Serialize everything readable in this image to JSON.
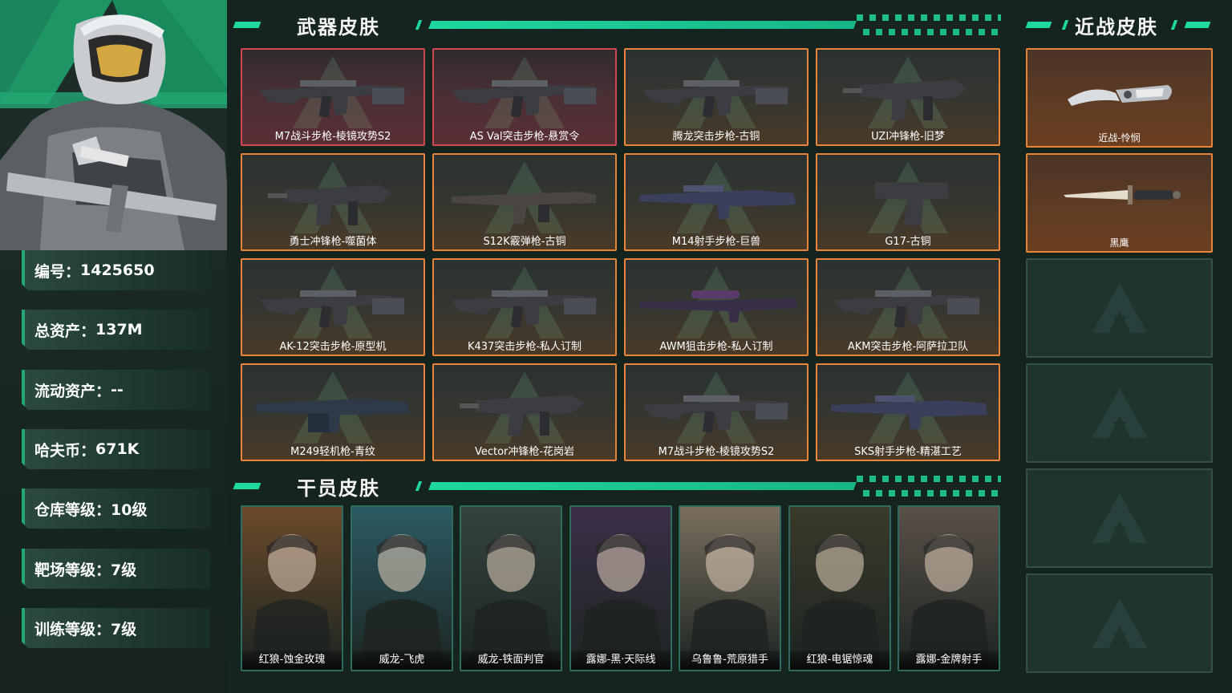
{
  "profile": {
    "stats": [
      {
        "label": "编号：",
        "value": "1425650"
      },
      {
        "label": "总资产：",
        "value": "137M"
      },
      {
        "label": "流动资产：",
        "value": "--"
      },
      {
        "label": "哈夫币：",
        "value": "671K"
      },
      {
        "label": "仓库等级：",
        "value": "10级"
      },
      {
        "label": "靶场等级：",
        "value": "7级"
      },
      {
        "label": "训练等级：",
        "value": "7级"
      }
    ]
  },
  "sections": {
    "weapon_title": "武器皮肤",
    "melee_title": "近战皮肤",
    "operator_title": "干员皮肤"
  },
  "weapons": [
    {
      "name": "M7战斗步枪-棱镜攻势S2",
      "rarity": "red",
      "icon": "rifle-icon"
    },
    {
      "name": "AS Val突击步枪-悬赏令",
      "rarity": "red",
      "icon": "rifle-icon"
    },
    {
      "name": "腾龙突击步枪-古铜",
      "rarity": "orange",
      "icon": "rifle-icon"
    },
    {
      "name": "UZI冲锋枪-旧梦",
      "rarity": "orange",
      "icon": "smg-icon"
    },
    {
      "name": "勇士冲锋枪-噬菌体",
      "rarity": "orange",
      "icon": "smg-icon"
    },
    {
      "name": "S12K霰弹枪-古铜",
      "rarity": "orange",
      "icon": "shotgun-icon"
    },
    {
      "name": "M14射手步枪-巨兽",
      "rarity": "orange",
      "icon": "marksman-rifle-icon"
    },
    {
      "name": "G17-古铜",
      "rarity": "orange",
      "icon": "pistol-icon"
    },
    {
      "name": "AK-12突击步枪-原型机",
      "rarity": "orange",
      "icon": "rifle-icon"
    },
    {
      "name": "K437突击步枪-私人订制",
      "rarity": "orange",
      "icon": "rifle-icon"
    },
    {
      "name": "AWM狙击步枪-私人订制",
      "rarity": "orange",
      "icon": "sniper-icon"
    },
    {
      "name": "AKM突击步枪-阿萨拉卫队",
      "rarity": "orange",
      "icon": "rifle-icon"
    },
    {
      "name": "M249轻机枪-青纹",
      "rarity": "orange",
      "icon": "lmg-icon"
    },
    {
      "name": "Vector冲锋枪-花岗岩",
      "rarity": "orange",
      "icon": "smg-icon"
    },
    {
      "name": "M7战斗步枪-棱镜攻势S2",
      "rarity": "orange",
      "icon": "rifle-icon"
    },
    {
      "name": "SKS射手步枪-精湛工艺",
      "rarity": "orange",
      "icon": "marksman-rifle-icon"
    }
  ],
  "melee": [
    {
      "name": "近战-怜悯",
      "icon": "karambit-icon"
    },
    {
      "name": "黑鹰",
      "icon": "knife-icon"
    }
  ],
  "operators": [
    {
      "name": "红狼-蚀金玫瑰",
      "bg": "#6b4a2a"
    },
    {
      "name": "威龙-飞虎",
      "bg": "#2c5a63"
    },
    {
      "name": "威龙-铁面判官",
      "bg": "#34433f"
    },
    {
      "name": "露娜-黑·天际线",
      "bg": "#3c2f48"
    },
    {
      "name": "乌鲁鲁-荒原猎手",
      "bg": "#7a6e5e"
    },
    {
      "name": "红狼-电锯惊魂",
      "bg": "#3b3a2a"
    },
    {
      "name": "露娜-金牌射手",
      "bg": "#5a5048"
    }
  ],
  "colors": {
    "accent": "#1fd7a0",
    "orange_border": "#e8853a",
    "red_border": "#d0474f"
  }
}
